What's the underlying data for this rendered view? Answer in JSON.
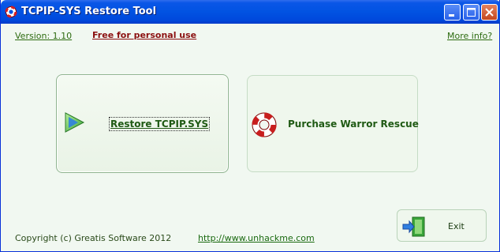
{
  "window": {
    "title": "TCPIP-SYS Restore Tool",
    "buttons": {
      "minimize": "minimize-icon",
      "maximize": "maximize-icon",
      "close": "close-icon"
    }
  },
  "header": {
    "version": "Version: 1.10",
    "license": "Free for personal use",
    "more_info": "More info?"
  },
  "actions": {
    "restore_label": "Restore TCPIP.SYS",
    "restore_icon": "play-arrow-icon",
    "purchase_label": "Purchase Warror Rescue",
    "purchase_icon": "life-ring-icon"
  },
  "footer": {
    "copyright": "Copyright (c) Greatis Software 2012",
    "website": "http://www.unhackme.com",
    "exit_label": "Exit",
    "exit_icon": "exit-door-icon"
  },
  "colors": {
    "titlebar": "#0153e2",
    "background": "#f1f8f1",
    "accent_green": "#1f5a14",
    "license_red": "#8b1010"
  }
}
